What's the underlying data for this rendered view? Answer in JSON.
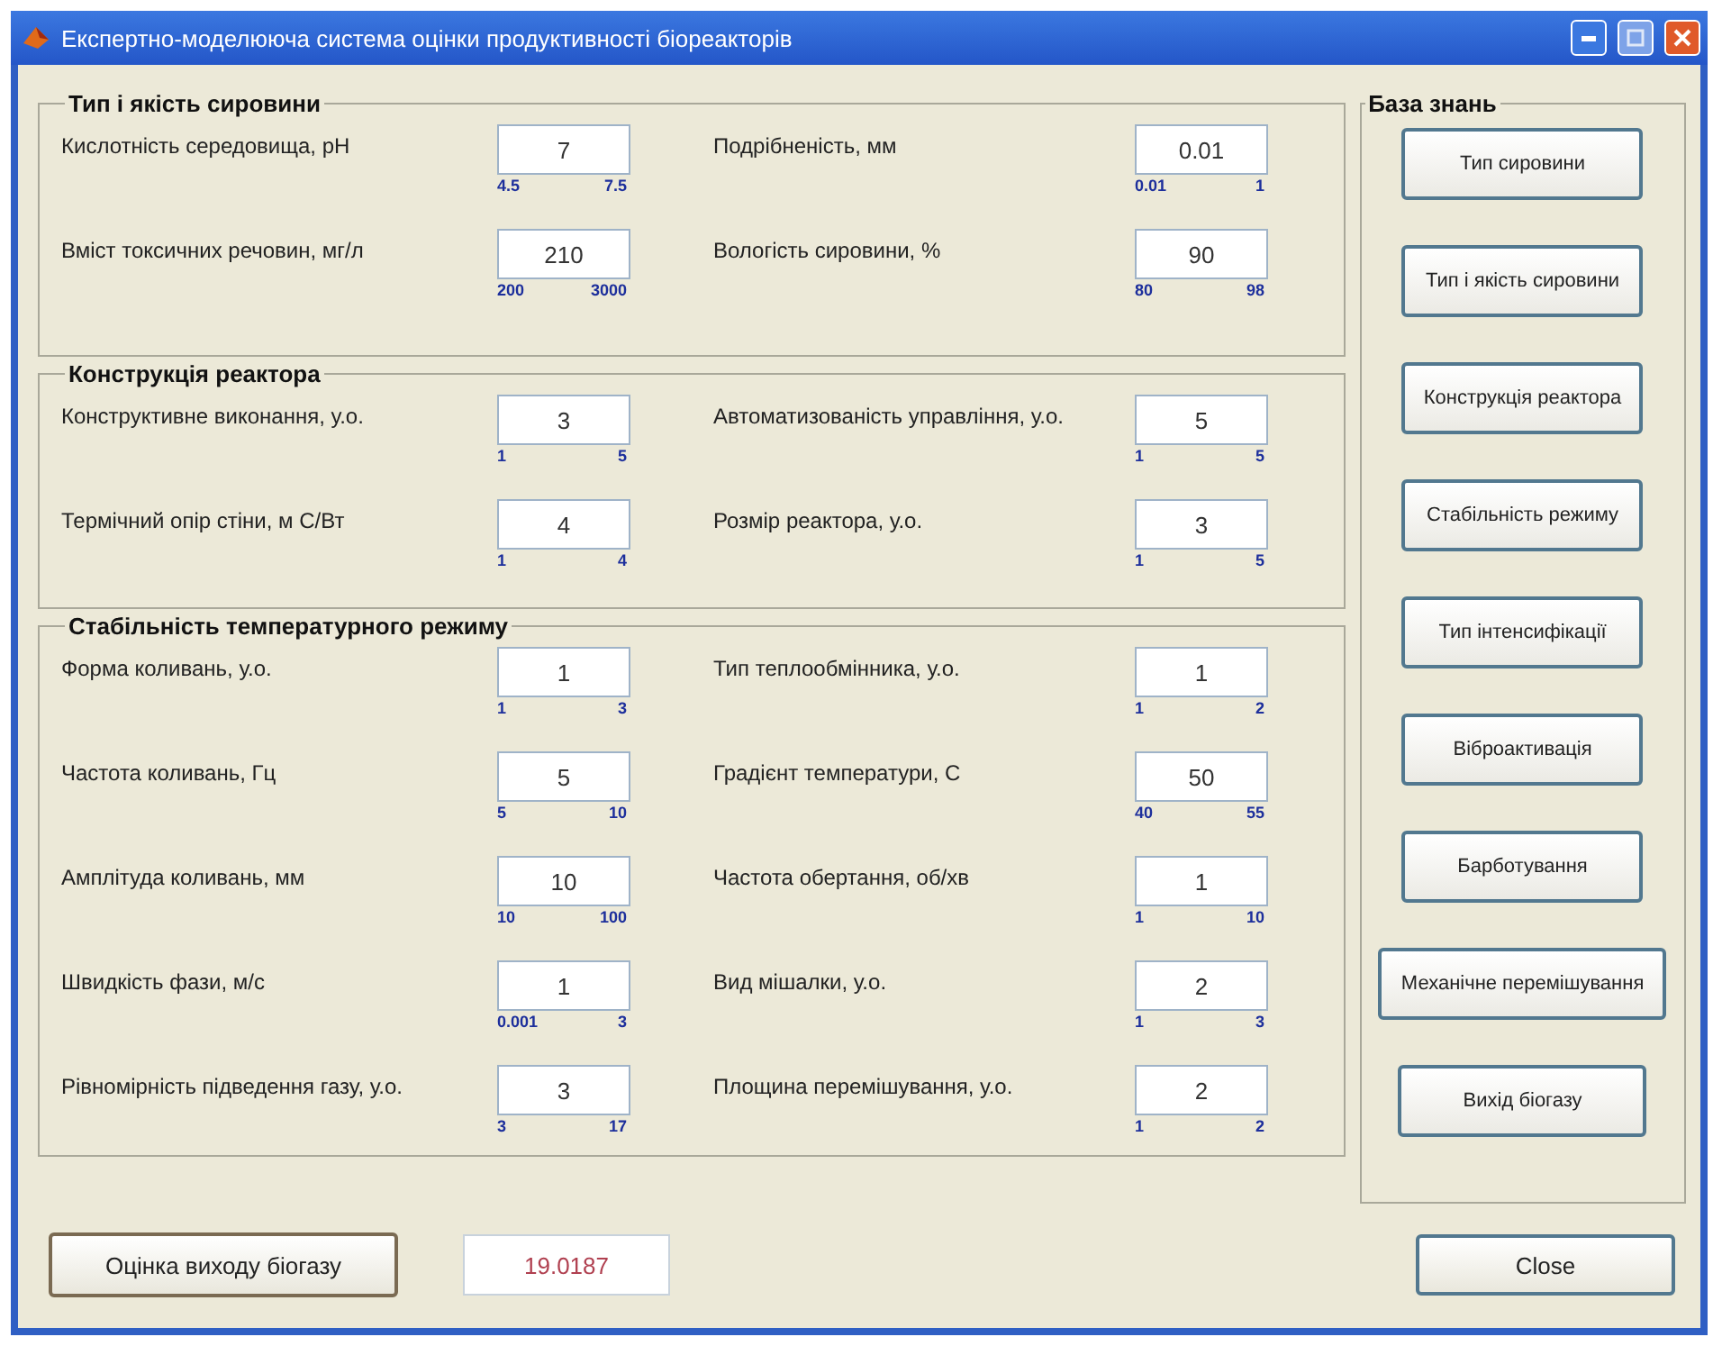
{
  "window": {
    "title": "Експертно-моделююча система оцінки продуктивності біореакторів"
  },
  "groups": [
    {
      "title": "Тип і якість сировини",
      "rows": [
        [
          {
            "label": "Кислотність середовища, pH",
            "value": "7",
            "min": "4.5",
            "max": "7.5"
          },
          {
            "label": "Подрібненість, мм",
            "value": "0.01",
            "min": "0.01",
            "max": "1"
          }
        ],
        [
          {
            "label": "Вміст токсичних речовин, мг/л",
            "value": "210",
            "min": "200",
            "max": "3000"
          },
          {
            "label": "Вологість сировини, %",
            "value": "90",
            "min": "80",
            "max": "98"
          }
        ]
      ]
    },
    {
      "title": "Конструкція реактора",
      "rows": [
        [
          {
            "label": "Конструктивне виконання, у.о.",
            "value": "3",
            "min": "1",
            "max": "5"
          },
          {
            "label": "Автоматизованість управління, у.о.",
            "value": "5",
            "min": "1",
            "max": "5"
          }
        ],
        [
          {
            "label": "Термічний опір стіни, м С/Вт",
            "value": "4",
            "min": "1",
            "max": "4"
          },
          {
            "label": "Розмір реактора, у.о.",
            "value": "3",
            "min": "1",
            "max": "5"
          }
        ]
      ]
    },
    {
      "title": "Стабільність температурного режиму",
      "rows": [
        [
          {
            "label": "Форма коливань, у.о.",
            "value": "1",
            "min": "1",
            "max": "3"
          },
          {
            "label": "Тип теплообмінника, у.о.",
            "value": "1",
            "min": "1",
            "max": "2"
          }
        ],
        [
          {
            "label": "Частота коливань, Гц",
            "value": "5",
            "min": "5",
            "max": "10"
          },
          {
            "label": "Градієнт температури, С",
            "value": "50",
            "min": "40",
            "max": "55"
          }
        ],
        [
          {
            "label": "Амплітуда коливань, мм",
            "value": "10",
            "min": "10",
            "max": "100"
          },
          {
            "label": "Частота обертання, об/хв",
            "value": "1",
            "min": "1",
            "max": "10"
          }
        ],
        [
          {
            "label": "Швидкість фази, м/с",
            "value": "1",
            "min": "0.001",
            "max": "3"
          },
          {
            "label": "Вид мішалки, у.о.",
            "value": "2",
            "min": "1",
            "max": "3"
          }
        ],
        [
          {
            "label": "Рівномірність підведення газу, у.о.",
            "value": "3",
            "min": "3",
            "max": "17"
          },
          {
            "label": "Площина перемішування, у.о.",
            "value": "2",
            "min": "1",
            "max": "2"
          }
        ]
      ]
    }
  ],
  "knowledge_base": {
    "title": "База знань",
    "buttons": [
      "Тип сировини",
      "Тип і якість сировини",
      "Конструкція реактора",
      "Стабільність режиму",
      "Тип інтенсифікації",
      "Віброактивація",
      "Барботування",
      "Механічне перемішування",
      "Вихід біогазу"
    ]
  },
  "estimate_button": "Оцінка виходу біогазу",
  "result": "19.0187",
  "close_button": "Close"
}
